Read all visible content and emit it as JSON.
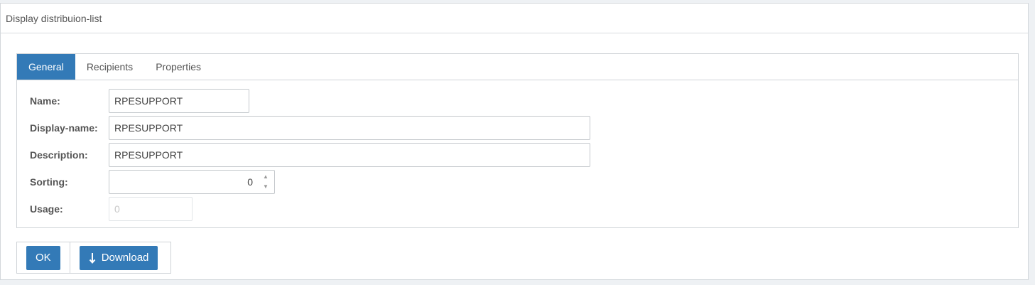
{
  "panel": {
    "title": "Display distribuion-list"
  },
  "tabs": [
    {
      "label": "General",
      "active": true
    },
    {
      "label": "Recipients",
      "active": false
    },
    {
      "label": "Properties",
      "active": false
    }
  ],
  "form": {
    "name": {
      "label": "Name:",
      "value": "RPESUPPORT"
    },
    "display_name": {
      "label": "Display-name:",
      "value": "RPESUPPORT"
    },
    "description": {
      "label": "Description:",
      "value": "RPESUPPORT"
    },
    "sorting": {
      "label": "Sorting:",
      "value": "0"
    },
    "usage": {
      "label": "Usage:",
      "value": "0"
    }
  },
  "buttons": {
    "ok": "OK",
    "download": "Download"
  },
  "icons": {
    "download": "arrow-down-icon",
    "spinner_up": "chevron-up-icon",
    "spinner_down": "chevron-down-icon"
  },
  "colors": {
    "accent": "#337ab7"
  }
}
